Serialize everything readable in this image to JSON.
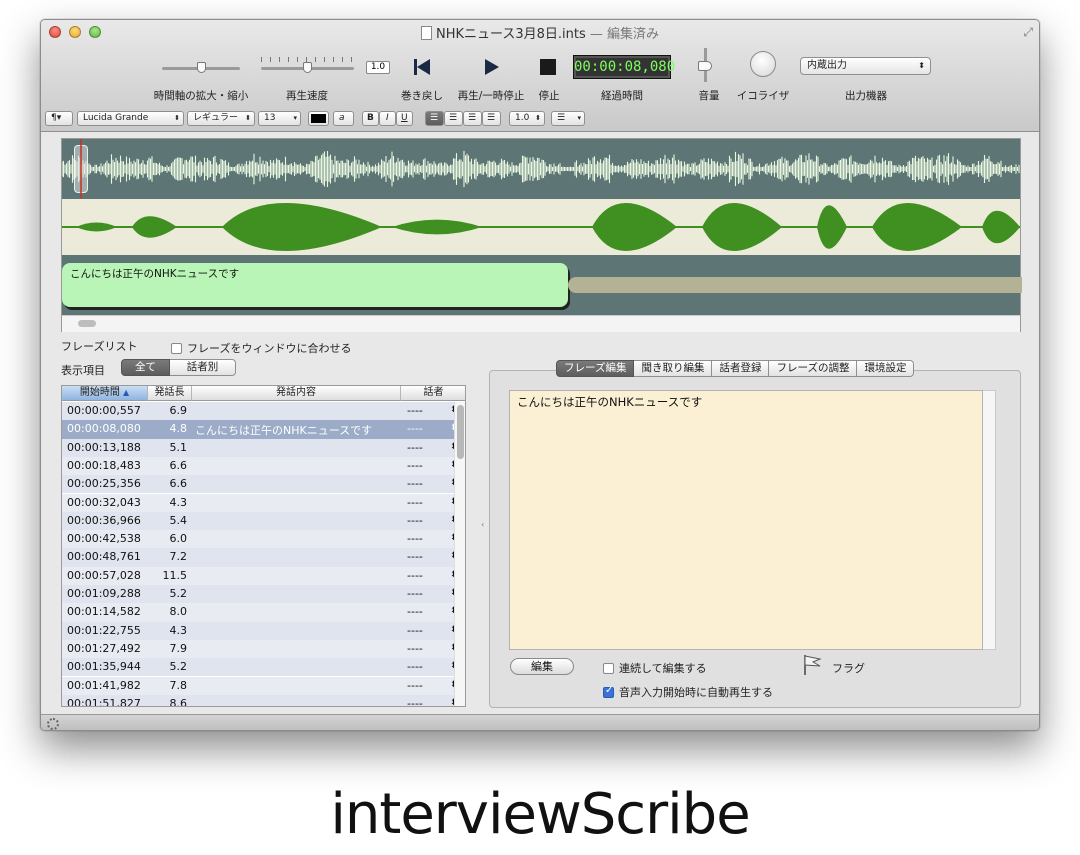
{
  "window": {
    "filename": "NHKニュース3月8日.ints",
    "edited_suffix": "— 編集済み"
  },
  "toolbar": {
    "zoom_label": "時間軸の拡大・縮小",
    "speed_label": "再生速度",
    "speed_value": "1.0",
    "rewind_label": "巻き戻し",
    "play_label": "再生/一時停止",
    "stop_label": "停止",
    "elapsed_label": "経過時間",
    "elapsed_value": "00:00:08,080",
    "volume_label": "音量",
    "equalizer_label": "イコライザ",
    "output_label": "出力機器",
    "output_value": "内蔵出力",
    "timeline_zoom_level": 0.5,
    "playback_speed_level": 0.5,
    "volume_level": 0.45
  },
  "format_bar": {
    "paragraph": "¶▾",
    "font": "Lucida Grande",
    "style": "レギュラー",
    "size": "13",
    "bold": "B",
    "italic": "I",
    "underline": "U",
    "spacing": "1.0",
    "text_color": "#000000"
  },
  "waveform": {
    "current_phrase": "こんにちは正午のNHKニュースです"
  },
  "phrase_list": {
    "title": "フレーズリスト",
    "fit_to_window": "フレーズをウィンドウに合わせる",
    "fit_to_window_checked": false,
    "display_label": "表示項目",
    "filter_all": "全て",
    "filter_speaker": "話者別",
    "columns": [
      "開始時間",
      "発話長",
      "発話内容",
      "話者"
    ],
    "rows": [
      {
        "time": "00:00:00,557",
        "len": "6.9",
        "content": "",
        "speaker": "----"
      },
      {
        "time": "00:00:08,080",
        "len": "4.8",
        "content": "こんにちは正午のNHKニュースです",
        "speaker": "----"
      },
      {
        "time": "00:00:13,188",
        "len": "5.1",
        "content": "",
        "speaker": "----"
      },
      {
        "time": "00:00:18,483",
        "len": "6.6",
        "content": "",
        "speaker": "----"
      },
      {
        "time": "00:00:25,356",
        "len": "6.6",
        "content": "",
        "speaker": "----"
      },
      {
        "time": "00:00:32,043",
        "len": "4.3",
        "content": "",
        "speaker": "----"
      },
      {
        "time": "00:00:36,966",
        "len": "5.4",
        "content": "",
        "speaker": "----"
      },
      {
        "time": "00:00:42,538",
        "len": "6.0",
        "content": "",
        "speaker": "----"
      },
      {
        "time": "00:00:48,761",
        "len": "7.2",
        "content": "",
        "speaker": "----"
      },
      {
        "time": "00:00:57,028",
        "len": "11.5",
        "content": "",
        "speaker": "----"
      },
      {
        "time": "00:01:09,288",
        "len": "5.2",
        "content": "",
        "speaker": "----"
      },
      {
        "time": "00:01:14,582",
        "len": "8.0",
        "content": "",
        "speaker": "----"
      },
      {
        "time": "00:01:22,755",
        "len": "4.3",
        "content": "",
        "speaker": "----"
      },
      {
        "time": "00:01:27,492",
        "len": "7.9",
        "content": "",
        "speaker": "----"
      },
      {
        "time": "00:01:35,944",
        "len": "5.2",
        "content": "",
        "speaker": "----"
      },
      {
        "time": "00:01:41,982",
        "len": "7.8",
        "content": "",
        "speaker": "----"
      },
      {
        "time": "00:01:51,827",
        "len": "8.6",
        "content": "",
        "speaker": "----"
      }
    ]
  },
  "editor": {
    "tabs": [
      "フレーズ編集",
      "聞き取り編集",
      "話者登録",
      "フレーズの調整",
      "環境設定"
    ],
    "active_tab": 0,
    "text": "こんにちは正午のNHKニュースです",
    "edit_button": "編集",
    "continuous_edit": "連続して編集する",
    "continuous_checked": false,
    "flag_label": "フラグ",
    "autoplay": "音声入力開始時に自動再生する",
    "autoplay_checked": true
  },
  "caption": "interviewScribe",
  "colors": {
    "waveform_bg": "#5d7575",
    "waveform_fg": "#e8f7e0",
    "envelope": "#3f8f21",
    "phrase_segment": "#baf5b8",
    "selected_row": "#9cabc8",
    "elapsed_text": "#7dff5e"
  }
}
